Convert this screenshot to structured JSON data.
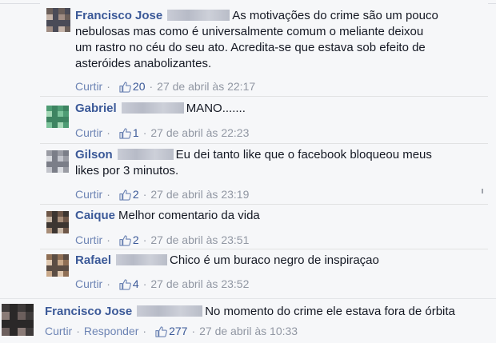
{
  "comments": [
    {
      "author": "Francisco Jose",
      "text_lines": [
        "As motivações do crime são um pouco",
        "nebulosas mas como é universalmente comum o meliante deixou",
        "um rastro no céu do seu ato. Acredita-se que estava sob efeito de",
        "asteróides anabolizantes."
      ],
      "actions": [
        "Curtir"
      ],
      "likes": "20",
      "timestamp": "27 de abril às 22:17",
      "avatar_colors": [
        "#6b5f5a",
        "#a08d84",
        "#4a4b57",
        "#c4b3a8"
      ]
    },
    {
      "author": "Gabriel",
      "text_lines": [
        "MANO......."
      ],
      "actions": [
        "Curtir"
      ],
      "likes": "1",
      "timestamp": "27 de abril às 22:23",
      "avatar_colors": [
        "#4e9c74",
        "#7cc39b",
        "#3d8461",
        "#a4d8b6"
      ]
    },
    {
      "author": "Gilson",
      "text_lines": [
        "Eu dei tanto like que o facebook bloqueou meus",
        "likes por 3 minutos."
      ],
      "actions": [
        "Curtir"
      ],
      "likes": "2",
      "timestamp": "27 de abril às 23:19",
      "avatar_colors": [
        "#9a9ca4",
        "#c3c5cc",
        "#7b7e88",
        "#d9dbe0"
      ]
    },
    {
      "author": "Caique",
      "text_lines": [
        "Melhor comentario da vida"
      ],
      "actions": [
        "Curtir"
      ],
      "likes": "2",
      "timestamp": "27 de abril às 23:51",
      "avatar_colors": [
        "#6e5748",
        "#a88e79",
        "#3d3631",
        "#c9b8a7"
      ]
    },
    {
      "author": "Rafael",
      "text_lines": [
        "Chico é um buraco negro de inspiraçao"
      ],
      "actions": [
        "Curtir"
      ],
      "likes": "4",
      "timestamp": "27 de abril às 23:52",
      "avatar_colors": [
        "#8f6f55",
        "#c9a98a",
        "#5b4d44",
        "#e0c9b1"
      ]
    }
  ],
  "main_comment": {
    "author": "Francisco Jose",
    "text_lines": [
      "No momento do crime ele estava fora de órbita"
    ],
    "actions": [
      "Curtir",
      "Responder"
    ],
    "likes": "277",
    "timestamp": "27 de abril às 10:33",
    "avatar_colors": [
      "#3e3a3a",
      "#6c5f5d",
      "#2a2828",
      "#8a7b77"
    ]
  },
  "colors": {
    "author_link": "#3b5998",
    "meta_gray": "#9197a3",
    "action_link": "#6d84b4",
    "background": "#f6f7f9"
  },
  "icons": {
    "like": "thumbs-up-icon"
  }
}
